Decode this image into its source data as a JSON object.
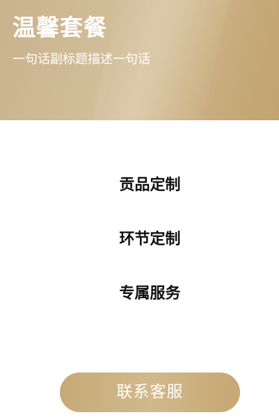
{
  "header": {
    "title": "温馨套餐",
    "subtitle": "一句话副标题描述一句话"
  },
  "menu": {
    "items": [
      {
        "label": "贡品定制"
      },
      {
        "label": "环节定制"
      },
      {
        "label": "专属服务"
      }
    ]
  },
  "footer": {
    "contact_label": "联系客服"
  },
  "colors": {
    "hero_gold": "#cfb892",
    "button_gold": "#c9ad7b",
    "text_dark": "#111111",
    "text_light": "#ffffff"
  }
}
